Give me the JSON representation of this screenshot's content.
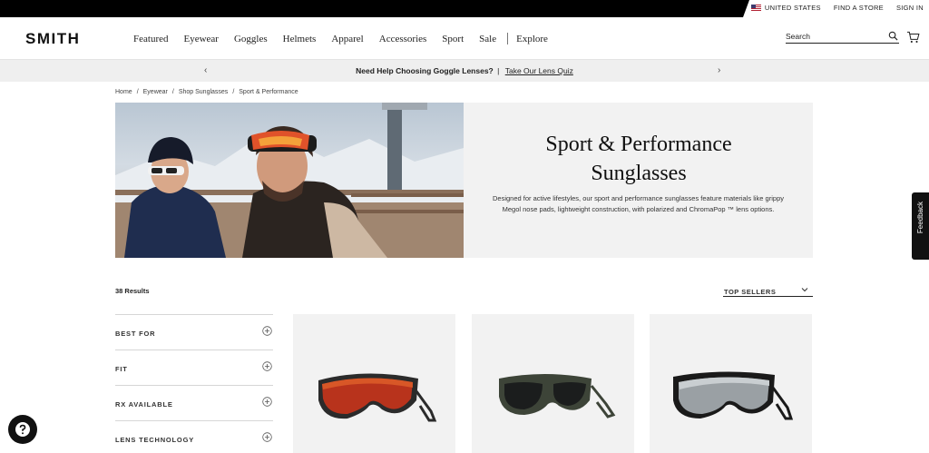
{
  "utility": {
    "country": "UNITED STATES",
    "find_store": "FIND A STORE",
    "sign_in": "SIGN IN"
  },
  "header": {
    "logo": "SMITH",
    "nav": [
      "Featured",
      "Eyewear",
      "Goggles",
      "Helmets",
      "Apparel",
      "Accessories",
      "Sport",
      "Sale"
    ],
    "explore": "Explore",
    "search_placeholder": "Search"
  },
  "promo": {
    "text": "Need Help Choosing Goggle Lenses?",
    "separator": "|",
    "link": "Take Our Lens Quiz"
  },
  "breadcrumb": [
    "Home",
    "Eyewear",
    "Shop Sunglasses",
    "Sport & Performance"
  ],
  "hero": {
    "title_line1": "Sport & Performance",
    "title_line2": "Sunglasses",
    "description": "Designed for active lifestyles, our sport and performance sunglasses feature materials like grippy Megol nose pads, lightweight construction, with polarized and ChromaPop ™ lens options."
  },
  "listing": {
    "results": "38 Results",
    "sort_label": "TOP SELLERS"
  },
  "filters": [
    "BEST FOR",
    "FIT",
    "RX AVAILABLE",
    "LENS TECHNOLOGY"
  ],
  "feedback": "Feedback",
  "icons": {
    "search": "search-icon",
    "cart": "cart-icon",
    "chevron_left": "chevron-left-icon",
    "chevron_right": "chevron-right-icon",
    "plus": "plus-circle-icon",
    "chat": "chat-icon"
  },
  "colors": {
    "utility_bar": "#000000",
    "promo_bg": "#efefef",
    "hero_bg": "#f2f2f2",
    "product_bg": "#f2f2f2"
  }
}
